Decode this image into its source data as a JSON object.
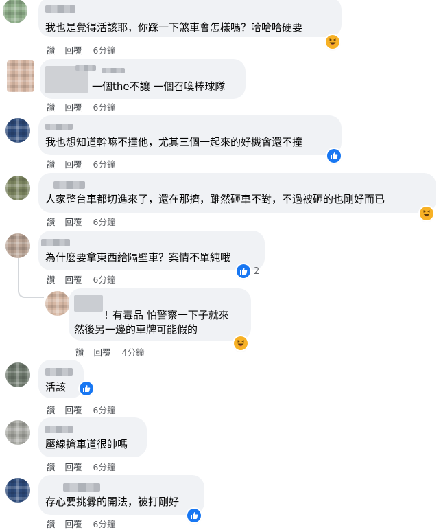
{
  "actions": {
    "like_label": "讚",
    "reply_label": "回覆"
  },
  "comments": [
    {
      "text": "我也是覺得活該耶，你踩一下煞車會怎樣嗎？哈哈哈硬要",
      "time": "6分鐘",
      "reaction": "haha-icon"
    },
    {
      "text": "一個the不讓 一個召喚棒球隊",
      "time": "6分鐘",
      "reaction": ""
    },
    {
      "text": "我也想知道幹嘛不撞他，尤其三個一起來的好機會還不撞",
      "time": "6分鐘",
      "reaction": "like-icon"
    },
    {
      "text": "人家整台車都切進來了，還在那擠，雖然砸車不對，不過被砸的也剛好而已",
      "time": "6分鐘",
      "reaction": "haha-icon"
    },
    {
      "text": "為什麼要拿東西給隔壁車？案情不單純哦",
      "time": "6分鐘",
      "reaction": "like-icon",
      "reaction_count": "2"
    },
    {
      "text": "活該",
      "time": "6分鐘",
      "reaction": "like-icon"
    },
    {
      "text": "壓線搶車道很帥嗎",
      "time": "6分鐘",
      "reaction": ""
    },
    {
      "text": "存心要挑釁的開法，被打剛好",
      "time": "6分鐘",
      "reaction": "like-icon"
    }
  ],
  "reply": {
    "line1": "有毒品 怕警察一下子就來",
    "line2": "然後另一邊的車牌可能假的",
    "time": "4分鐘",
    "reaction": "haha-icon"
  },
  "colors": {
    "bubble": "#f0f2f5",
    "like": "#1877f2",
    "haha": "#f7b125",
    "meta": "#65676b"
  }
}
